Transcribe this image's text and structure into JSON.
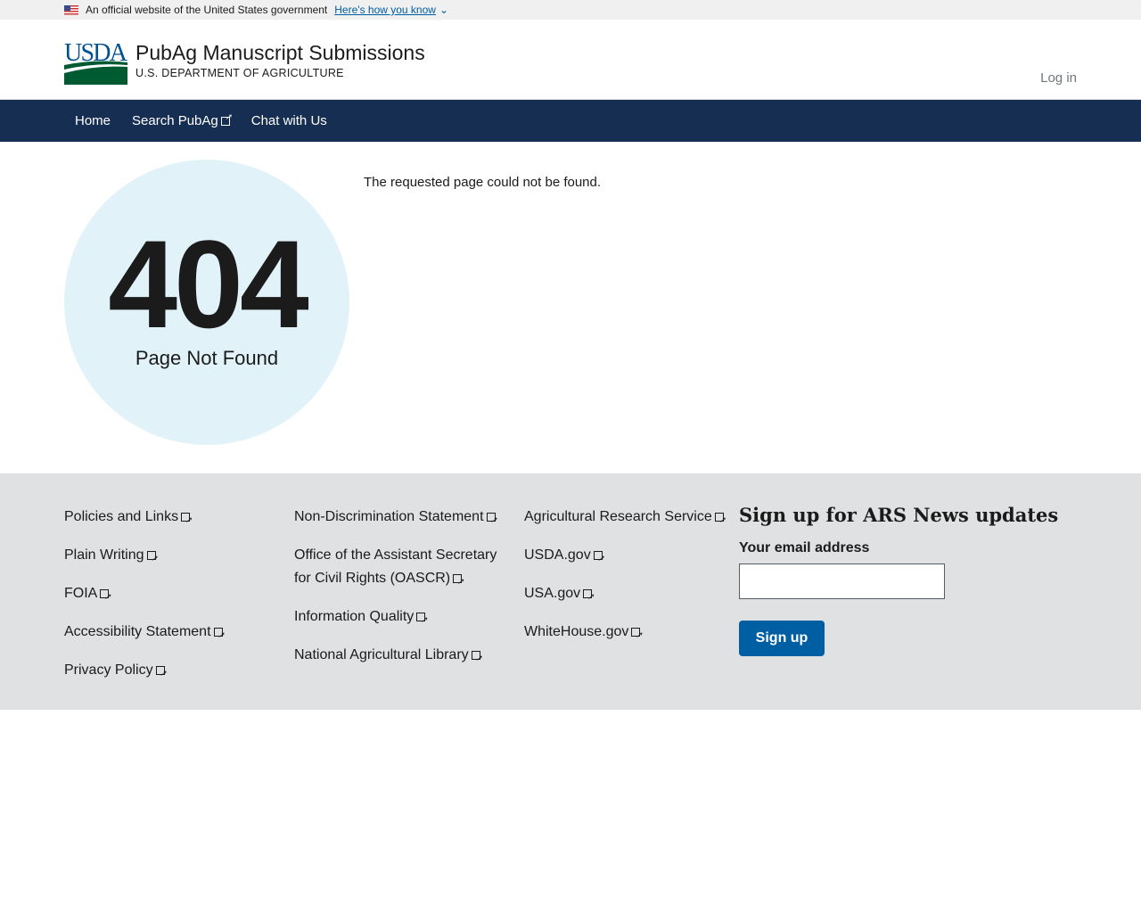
{
  "banner": {
    "text": "An official website of the United States government",
    "link": "Here's how you know"
  },
  "header": {
    "logo": "USDA",
    "title": "PubAg Manuscript Submissions",
    "subtitle": "U.S. DEPARTMENT OF AGRICULTURE",
    "login": "Log in"
  },
  "nav": [
    "Home",
    "Search PubAg",
    "Chat with Us"
  ],
  "main": {
    "code": "404",
    "heading": "Page Not Found",
    "message": "The requested page could not be found."
  },
  "footer": {
    "col1": [
      "Policies and Links",
      "Plain Writing",
      "FOIA",
      "Accessibility Statement",
      "Privacy Policy"
    ],
    "col2": [
      "Non-Discrimination Statement",
      "Office of the Assistant Secretary for Civil Rights (OASCR)",
      "Information Quality",
      "National Agricultural Library"
    ],
    "col3": [
      "Agricultural Research Service",
      "USDA.gov",
      "USA.gov",
      "WhiteHouse.gov"
    ],
    "signup": {
      "heading": "Sign up for ARS News updates",
      "label": "Your email address",
      "button": "Sign up"
    }
  }
}
